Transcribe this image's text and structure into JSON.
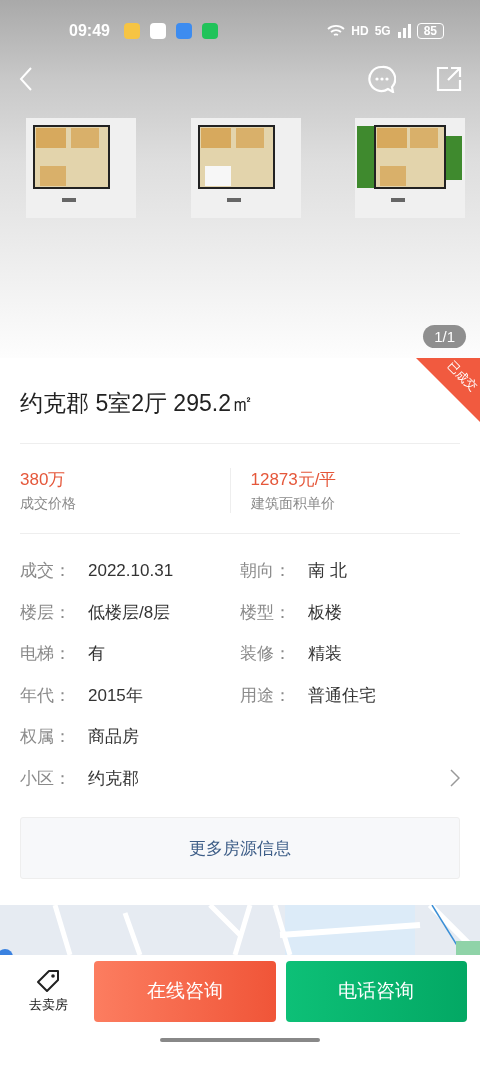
{
  "status_bar": {
    "time": "09:49",
    "hd": "HD",
    "network": "5G",
    "battery": "85"
  },
  "gallery": {
    "counter": "1/1"
  },
  "listing": {
    "badge": "已成交",
    "title": "约克郡 5室2厅 295.2㎡"
  },
  "prices": [
    {
      "value": "380万",
      "label": "成交价格"
    },
    {
      "value": "12873元/平",
      "label": "建筑面积单价"
    }
  ],
  "detail_rows": [
    {
      "link": false,
      "cells": [
        {
          "label": "成交：",
          "value": "2022.10.31"
        },
        {
          "label": "朝向：",
          "value": "南 北"
        }
      ]
    },
    {
      "link": false,
      "cells": [
        {
          "label": "楼层：",
          "value": "低楼层/8层"
        },
        {
          "label": "楼型：",
          "value": "板楼"
        }
      ]
    },
    {
      "link": false,
      "cells": [
        {
          "label": "电梯：",
          "value": "有"
        },
        {
          "label": "装修：",
          "value": "精装"
        }
      ]
    },
    {
      "link": false,
      "cells": [
        {
          "label": "年代：",
          "value": "2015年"
        },
        {
          "label": "用途：",
          "value": "普通住宅"
        }
      ]
    },
    {
      "link": false,
      "cells": [
        {
          "label": "权属：",
          "value": "商品房"
        }
      ]
    },
    {
      "link": true,
      "cells": [
        {
          "label": "小区：",
          "value": "约克郡"
        }
      ]
    }
  ],
  "more_button": "更多房源信息",
  "bottom_bar": {
    "sell": "去卖房",
    "buttons": [
      {
        "label": "在线咨询",
        "kind": "chat"
      },
      {
        "label": "电话咨询",
        "kind": "phone"
      }
    ]
  }
}
